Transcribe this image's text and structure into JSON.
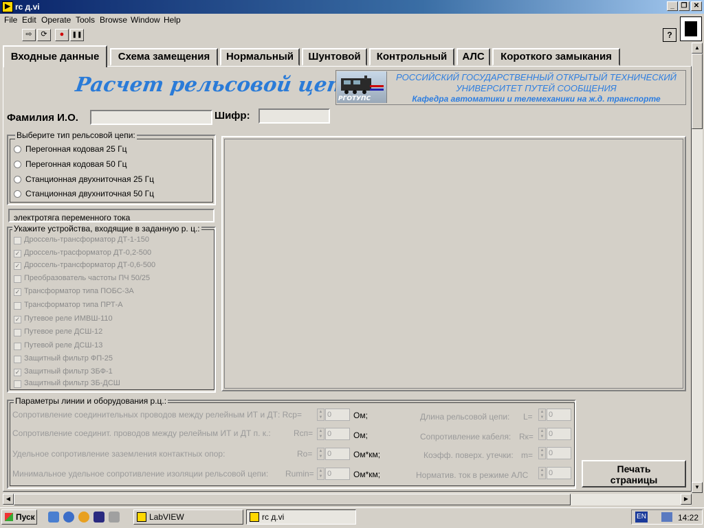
{
  "window": {
    "title": "rc д.vi",
    "min": "_",
    "restore": "❐",
    "close": "✕"
  },
  "menu": [
    "File",
    "Edit",
    "Operate",
    "Tools",
    "Browse",
    "Window",
    "Help"
  ],
  "toolbar": {
    "run": "⇨",
    "run_continuous": "⟳",
    "abort": "●",
    "pause": "❚❚",
    "help": "?"
  },
  "tabs": [
    "Входные данные",
    "Схема замещения",
    "Нормальный",
    "Шунтовой",
    "Контрольный",
    "АЛС",
    "Короткого замыкания"
  ],
  "active_tab": 0,
  "heading": "Расчет рельсовой цепи",
  "logo_text": "РГОТУПС",
  "university": {
    "line1": "РОССИЙСКИЙ ГОСУДАРСТВЕННЫЙ ОТКРЫТЫЙ ТЕХНИЧЕСКИЙ",
    "line2": "УНИВЕРСИТЕТ ПУТЕЙ СООБЩЕНИЯ",
    "line3": "Кафедра автоматики и телемеханики на ж.д. транспорте"
  },
  "student": {
    "fio_label": "Фамилия И.О.",
    "fio_value": "",
    "code_label": "Шифр:",
    "code_value": ""
  },
  "circuit_type": {
    "legend": "Выберите тип рельсовой цепи:",
    "options": [
      "Перегонная кодовая 25 Гц",
      "Перегонная кодовая 50 Гц",
      "Станционная двухниточная 25 Гц",
      "Станционная двухниточная 50 Гц"
    ]
  },
  "traction": "электротяга переменного тока",
  "devices": {
    "legend": "Укажите устройства, входящие в заданную р. ц.:",
    "items": [
      {
        "label": "Дроссель-трансформатор ДТ-1-150",
        "checked": false
      },
      {
        "label": "Дроссель-трасформатор ДТ-0,2-500",
        "checked": true
      },
      {
        "label": "Дроссель-трансформатор ДТ-0,6-500",
        "checked": true
      },
      {
        "label": "Преобразователь частоты ПЧ 50/25",
        "checked": false
      },
      {
        "label": "Трансформатор типа  ПОБС-3А",
        "checked": true
      },
      {
        "label": "Трансформатор типа  ПРТ-А",
        "checked": false
      },
      {
        "label": "Путевое реле ИМВШ-110",
        "checked": true
      },
      {
        "label": "Путевое реле ДСШ-12",
        "checked": false
      },
      {
        "label": "Путевой реле ДСШ-13",
        "checked": false
      },
      {
        "label": "Защитный фильтр ФП-25",
        "checked": false
      },
      {
        "label": "Защитный фильтр ЗБФ-1",
        "checked": true
      },
      {
        "label": "Защитный фильтр ЗБ-ДСШ",
        "checked": false
      }
    ]
  },
  "params": {
    "legend": "Параметры линии и оборудования р.ц.:",
    "left": [
      {
        "label": "Сопротивление соединительных проводов между релейным ИТ и ДТ: Rср=",
        "value": "0",
        "unit": "Ом;"
      },
      {
        "label": "Сопротивление соединит. проводов между релейным ИТ и ДТ п. к.:",
        "sym": "Rсп=",
        "value": "0",
        "unit": "Ом;"
      },
      {
        "label": "Удельное сопротивление заземления контактных опор:",
        "sym": "Ro=",
        "value": "0",
        "unit": "Ом*км;"
      },
      {
        "label": "Минимальное удельное сопротивление изоляции рельсовой цепи:",
        "sym": "Rumin=",
        "value": "0",
        "unit": "Ом*км;"
      }
    ],
    "right": [
      {
        "label": "Длина рельсовой цепи:",
        "sym": "L=",
        "value": "0"
      },
      {
        "label": "Сопротивление кабеля:",
        "sym": "Rк=",
        "value": "0"
      },
      {
        "label": "Коэфф. поверх. утечки:",
        "sym": "m=",
        "value": "0"
      },
      {
        "label": "Норматив. ток в режиме АЛС",
        "sym": "",
        "value": "0"
      }
    ]
  },
  "print_button": {
    "line1": "Печать",
    "line2": "страницы"
  },
  "taskbar": {
    "start": "Пуск",
    "tasks": [
      "LabVIEW",
      "rc д.vi"
    ],
    "lang": "EN",
    "clock": "14:22"
  }
}
